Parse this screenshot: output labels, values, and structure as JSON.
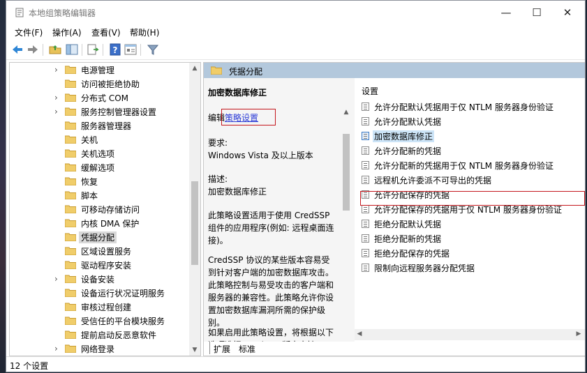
{
  "window": {
    "title": "本地组策略编辑器",
    "controls": {
      "minimize": "—",
      "maximize": "☐",
      "close": "✕"
    }
  },
  "menu": [
    "文件(F)",
    "操作(A)",
    "查看(V)",
    "帮助(H)"
  ],
  "toolbar": {
    "icons": [
      "back-icon",
      "forward-icon",
      "up-folder-icon",
      "show-hide-tree-icon",
      "export-list-icon",
      "help-icon",
      "properties-icon",
      "filter-icon"
    ]
  },
  "tree": {
    "items": [
      {
        "label": "电源管理",
        "expandable": true
      },
      {
        "label": "访问被拒绝协助",
        "expandable": false
      },
      {
        "label": "分布式 COM",
        "expandable": true
      },
      {
        "label": "服务控制管理器设置",
        "expandable": true
      },
      {
        "label": "服务器管理器",
        "expandable": false
      },
      {
        "label": "关机",
        "expandable": false
      },
      {
        "label": "关机选项",
        "expandable": false
      },
      {
        "label": "缓解选项",
        "expandable": false
      },
      {
        "label": "恢复",
        "expandable": false
      },
      {
        "label": "脚本",
        "expandable": false
      },
      {
        "label": "可移动存储访问",
        "expandable": false
      },
      {
        "label": "内核 DMA 保护",
        "expandable": false
      },
      {
        "label": "凭据分配",
        "expandable": false,
        "selected": true
      },
      {
        "label": "区域设置服务",
        "expandable": false
      },
      {
        "label": "驱动程序安装",
        "expandable": false
      },
      {
        "label": "设备安装",
        "expandable": true
      },
      {
        "label": "设备运行状况证明服务",
        "expandable": false
      },
      {
        "label": "审核过程创建",
        "expandable": false
      },
      {
        "label": "受信任的平台模块服务",
        "expandable": false
      },
      {
        "label": "提前启动反恶意软件",
        "expandable": false
      },
      {
        "label": "网络登录",
        "expandable": true
      }
    ]
  },
  "banner": {
    "title": "凭据分配"
  },
  "description": {
    "heading": "加密数据库修正",
    "edit_prefix": "编辑",
    "edit_link": "策略设置",
    "requirements_label": "要求:",
    "requirements_value": "Windows Vista 及以上版本",
    "description_label": "描述:",
    "description_value": "加密数据库修正",
    "para1": "此策略设置适用于使用 CredSSP 组件的应用程序(例如: 远程桌面连接)。",
    "para2": "CredSSP 协议的某些版本容易受到针对客户端的加密数据库攻击。此策略控制与易受攻击的客户端和服务器的兼容性。此策略允许你设置加密数据库漏洞所需的保护级别。",
    "para3": "如果启用此策略设置，将根据以下选项选择 CredSSP 版本支持"
  },
  "list": {
    "column_header": "设置",
    "items": [
      "允许分配默认凭据用于仅 NTLM 服务器身份验证",
      "允许分配默认凭据",
      "加密数据库修正",
      "允许分配新的凭据",
      "允许分配新的凭据用于仅 NTLM 服务器身份验证",
      "远程机允许委派不可导出的凭据",
      "允许分配保存的凭据",
      "允许分配保存的凭据用于仅 NTLM 服务器身份验证",
      "拒绝分配默认凭据",
      "拒绝分配新的凭据",
      "拒绝分配保存的凭据",
      "限制向远程服务器分配凭据"
    ],
    "selected_index": 2
  },
  "tabs": {
    "extended": "扩展",
    "standard": "标准"
  },
  "status": {
    "text": "12 个设置"
  }
}
